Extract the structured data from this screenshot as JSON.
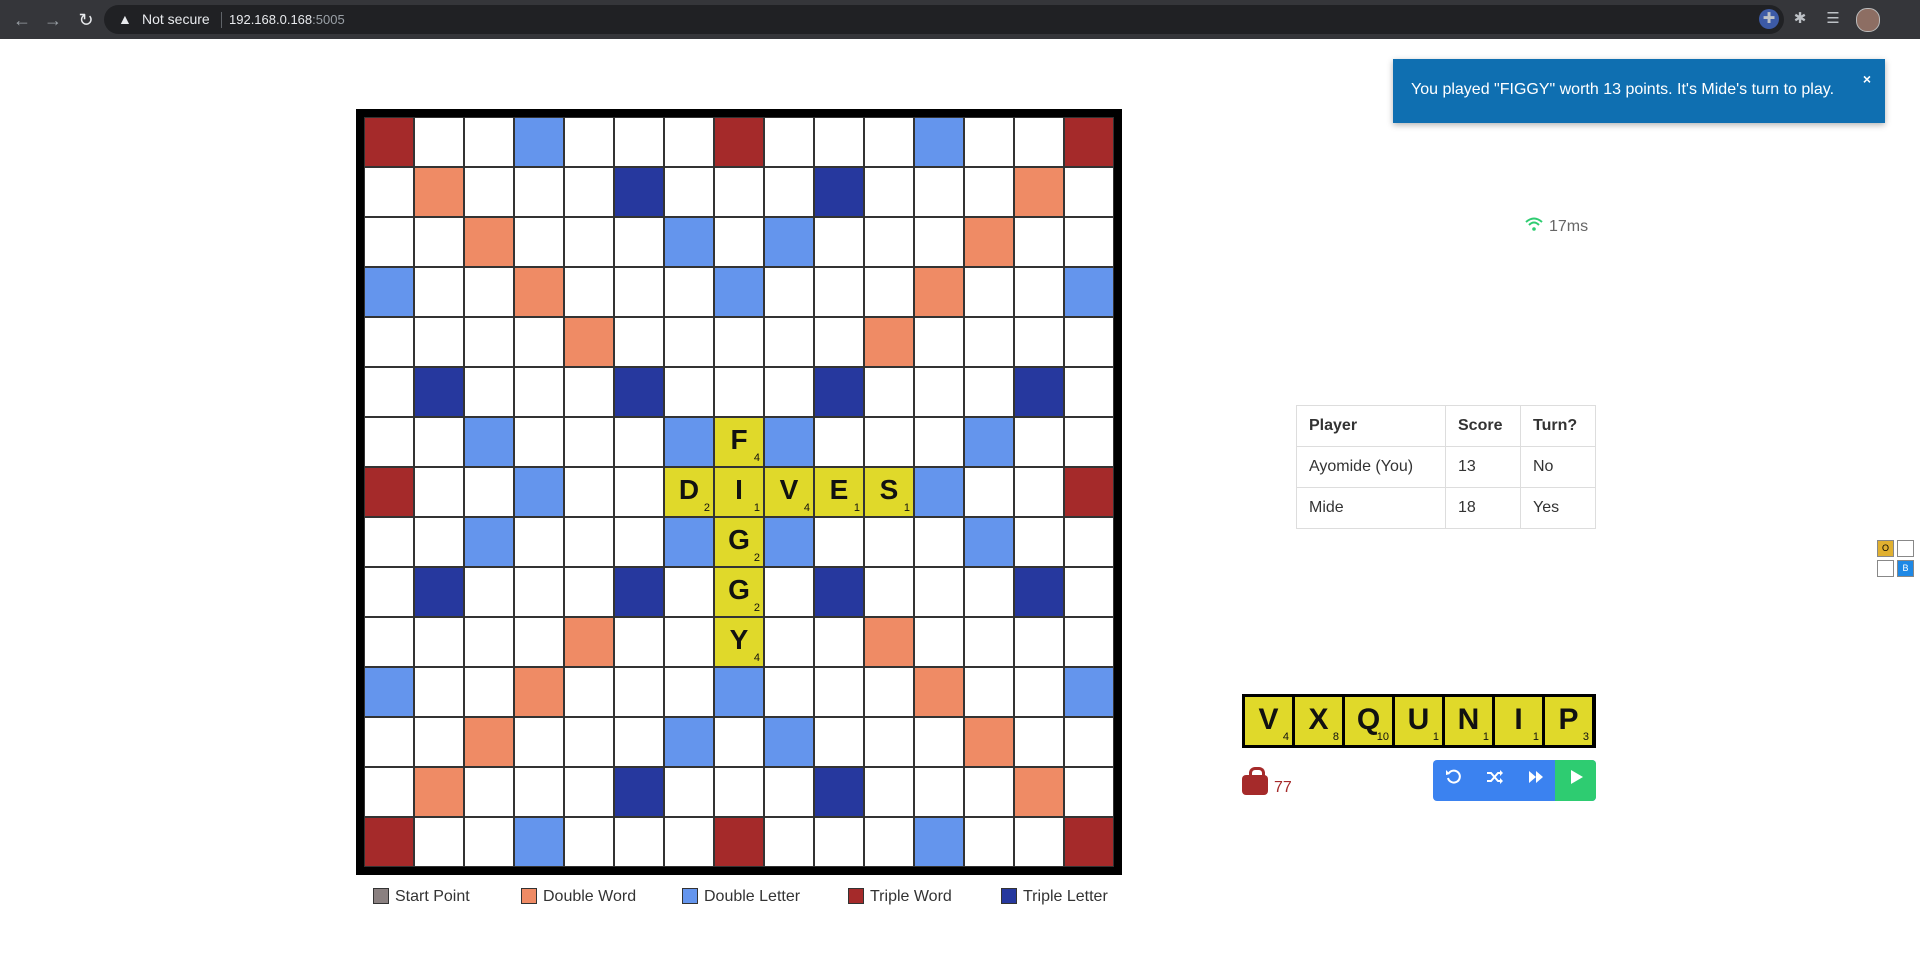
{
  "browser": {
    "security_label": "Not secure",
    "host": "192.168.0.168",
    "port": ":5005"
  },
  "board": {
    "rows": [
      [
        "tw",
        "",
        "",
        "dl",
        "",
        "",
        "",
        "tw",
        "",
        "",
        "",
        "dl",
        "",
        "",
        "tw"
      ],
      [
        "",
        "dw",
        "",
        "",
        "",
        "tl",
        "",
        "",
        "",
        "tl",
        "",
        "",
        "",
        "dw",
        ""
      ],
      [
        "",
        "",
        "dw",
        "",
        "",
        "",
        "dl",
        "",
        "dl",
        "",
        "",
        "",
        "dw",
        "",
        ""
      ],
      [
        "dl",
        "",
        "",
        "dw",
        "",
        "",
        "",
        "dl",
        "",
        "",
        "",
        "dw",
        "",
        "",
        "dl"
      ],
      [
        "",
        "",
        "",
        "",
        "dw",
        "",
        "",
        "",
        "",
        "",
        "dw",
        "",
        "",
        "",
        ""
      ],
      [
        "",
        "tl",
        "",
        "",
        "",
        "tl",
        "",
        "",
        "",
        "tl",
        "",
        "",
        "",
        "tl",
        ""
      ],
      [
        "",
        "",
        "dl",
        "",
        "",
        "",
        "dl",
        "",
        "dl",
        "",
        "",
        "",
        "dl",
        "",
        ""
      ],
      [
        "tw",
        "",
        "",
        "dl",
        "",
        "",
        "",
        "",
        "",
        "",
        "",
        "dl",
        "",
        "",
        "tw"
      ],
      [
        "",
        "",
        "dl",
        "",
        "",
        "",
        "dl",
        "",
        "dl",
        "",
        "",
        "",
        "dl",
        "",
        ""
      ],
      [
        "",
        "tl",
        "",
        "",
        "",
        "tl",
        "",
        "",
        "",
        "tl",
        "",
        "",
        "",
        "tl",
        ""
      ],
      [
        "",
        "",
        "",
        "",
        "dw",
        "",
        "",
        "",
        "",
        "",
        "dw",
        "",
        "",
        "",
        ""
      ],
      [
        "dl",
        "",
        "",
        "dw",
        "",
        "",
        "",
        "dl",
        "",
        "",
        "",
        "dw",
        "",
        "",
        "dl"
      ],
      [
        "",
        "",
        "dw",
        "",
        "",
        "",
        "dl",
        "",
        "dl",
        "",
        "",
        "",
        "dw",
        "",
        ""
      ],
      [
        "",
        "dw",
        "",
        "",
        "",
        "tl",
        "",
        "",
        "",
        "tl",
        "",
        "",
        "",
        "dw",
        ""
      ],
      [
        "tw",
        "",
        "",
        "dl",
        "",
        "",
        "",
        "tw",
        "",
        "",
        "",
        "dl",
        "",
        "",
        "tw"
      ]
    ],
    "tiles": [
      {
        "row": 6,
        "col": 7,
        "letter": "F",
        "score": "4"
      },
      {
        "row": 7,
        "col": 6,
        "letter": "D",
        "score": "2"
      },
      {
        "row": 7,
        "col": 7,
        "letter": "I",
        "score": "1"
      },
      {
        "row": 7,
        "col": 8,
        "letter": "V",
        "score": "4"
      },
      {
        "row": 7,
        "col": 9,
        "letter": "E",
        "score": "1"
      },
      {
        "row": 7,
        "col": 10,
        "letter": "S",
        "score": "1"
      },
      {
        "row": 8,
        "col": 7,
        "letter": "G",
        "score": "2"
      },
      {
        "row": 9,
        "col": 7,
        "letter": "G",
        "score": "2"
      },
      {
        "row": 10,
        "col": 7,
        "letter": "Y",
        "score": "4"
      }
    ]
  },
  "legend": {
    "start": "Start Point",
    "double_word": "Double Word",
    "double_letter": "Double Letter",
    "triple_word": "Triple Word",
    "triple_letter": "Triple Letter"
  },
  "toast": {
    "message": "You played \"FIGGY\" worth 13 points. It's Mide's turn to play.",
    "close": "×"
  },
  "latency": "17ms",
  "scoreboard": {
    "headers": [
      "Player",
      "Score",
      "Turn?"
    ],
    "rows": [
      [
        "Ayomide (You)",
        "13",
        "No"
      ],
      [
        "Mide",
        "18",
        "Yes"
      ]
    ]
  },
  "rack": [
    {
      "letter": "V",
      "score": "4"
    },
    {
      "letter": "X",
      "score": "8"
    },
    {
      "letter": "Q",
      "score": "10"
    },
    {
      "letter": "U",
      "score": "1"
    },
    {
      "letter": "N",
      "score": "1"
    },
    {
      "letter": "I",
      "score": "1"
    },
    {
      "letter": "P",
      "score": "3"
    }
  ],
  "bag_count": "77",
  "colors": {
    "triple_word": "#a52a2a",
    "double_word": "#ef8b65",
    "double_letter": "#6495ed",
    "triple_letter": "#26389e",
    "tile": "#e0d92a",
    "start": "#8a8080",
    "toast": "#0f6fb1",
    "play": "#2ecc71"
  },
  "mini_widget": {
    "o": "O",
    "b": "B"
  }
}
